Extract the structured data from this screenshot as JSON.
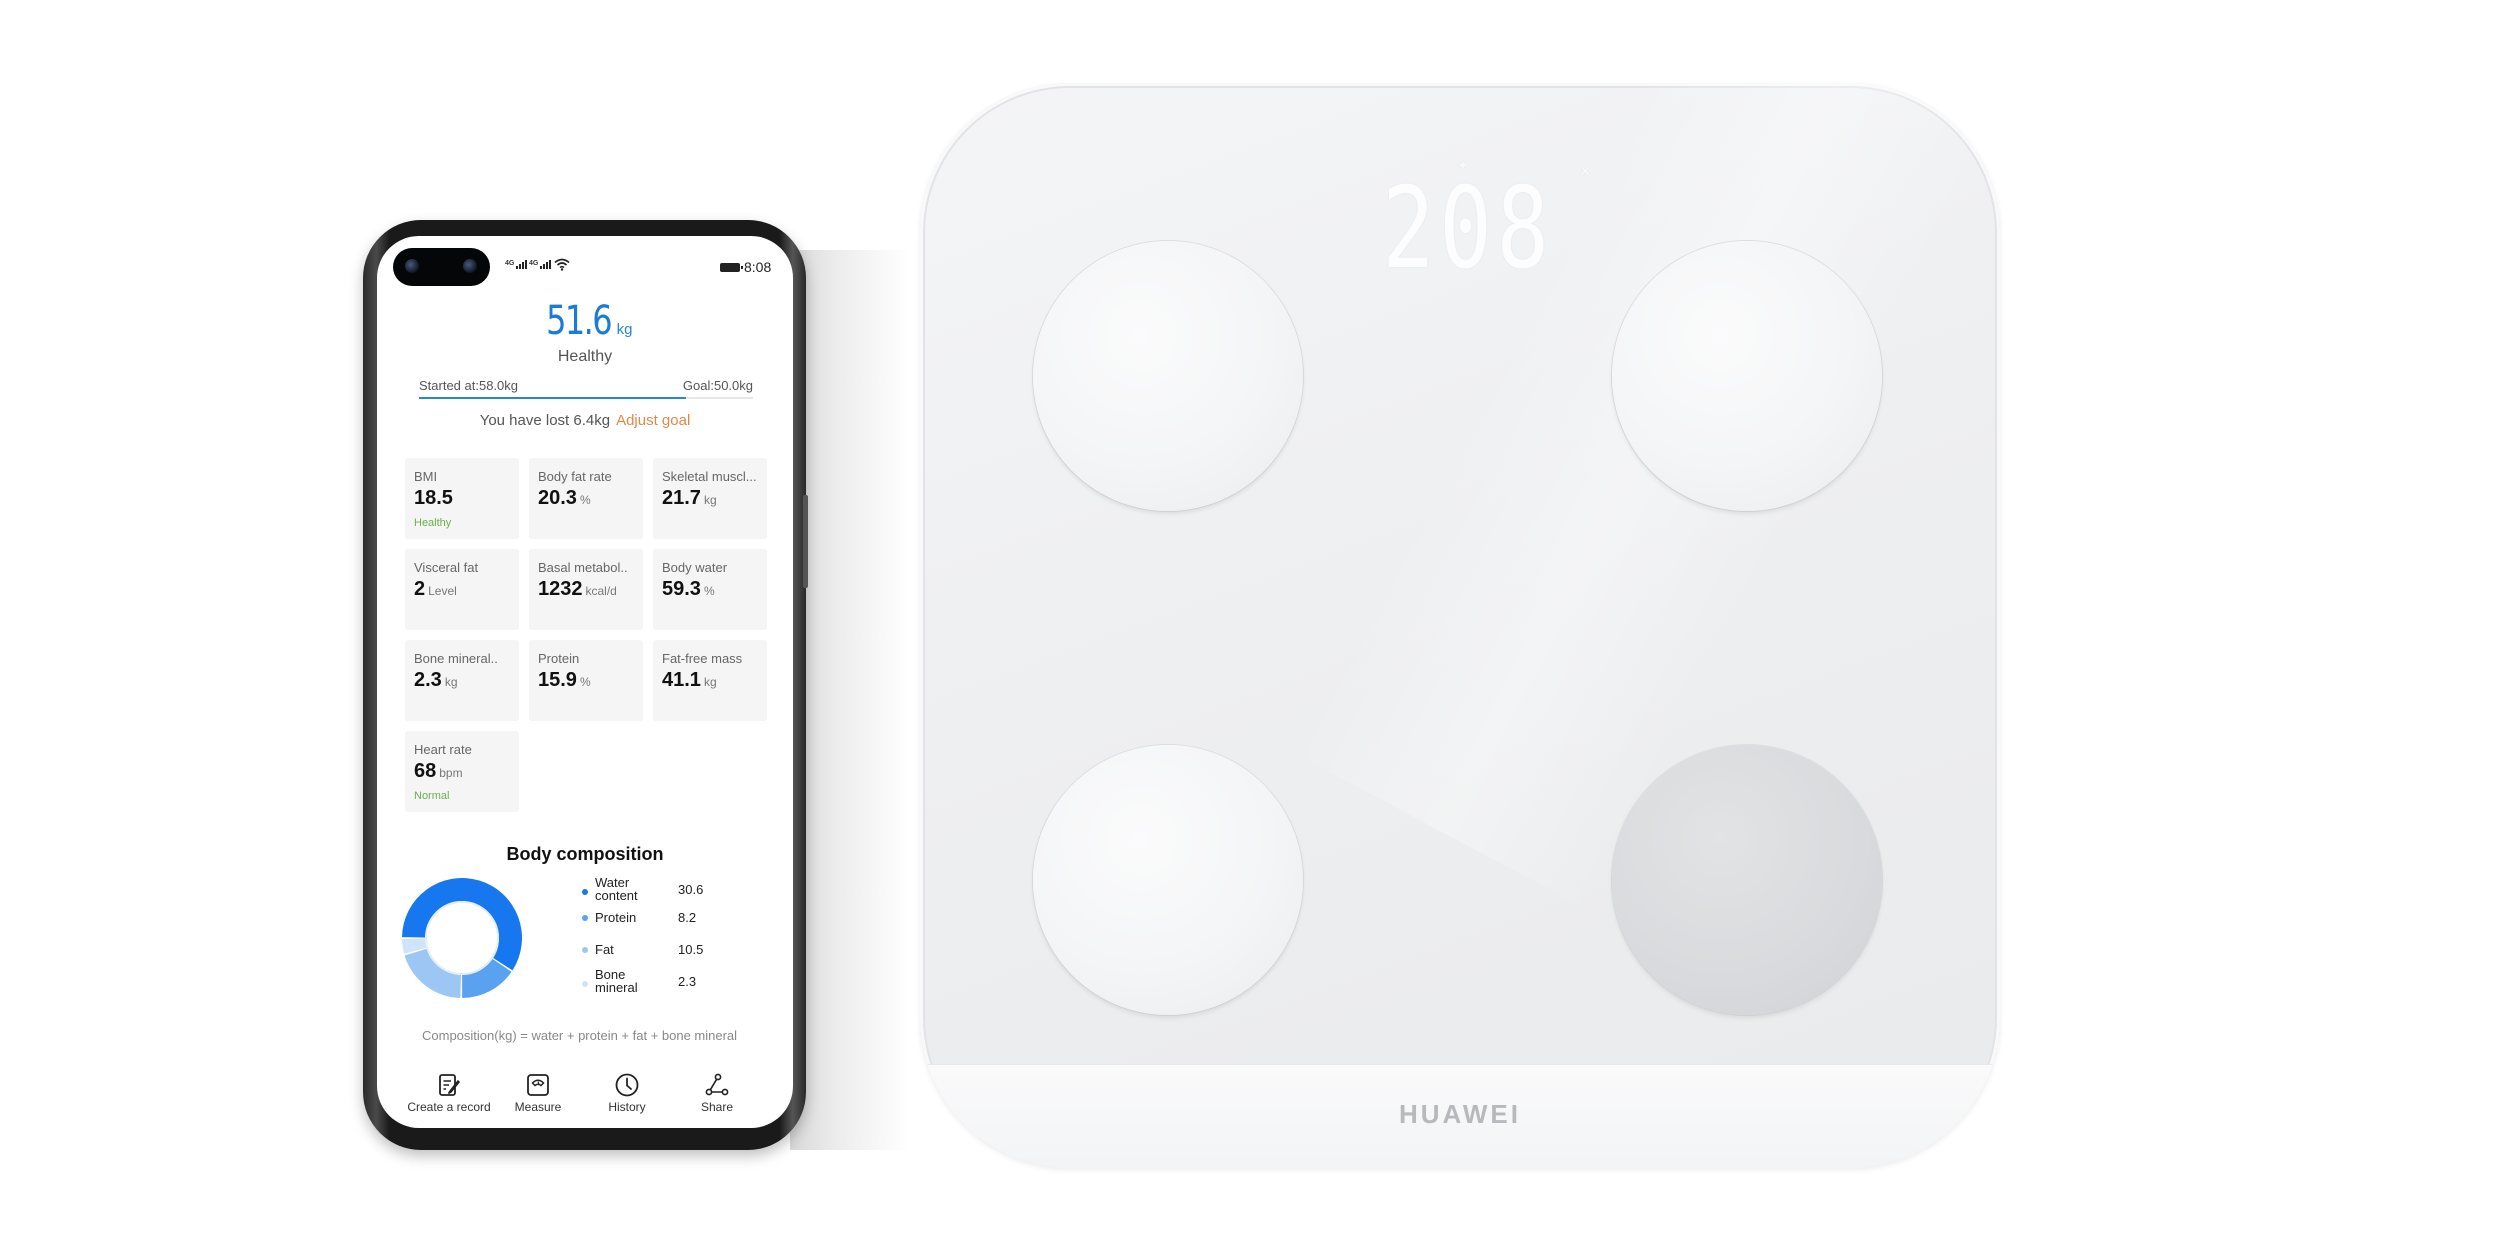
{
  "status_bar": {
    "network_1": "4G",
    "network_2": "4G",
    "wifi_icon": "wifi-icon",
    "battery_icon": "battery-icon",
    "time": "8:08"
  },
  "summary": {
    "weight_value": "51.6",
    "weight_unit": "kg",
    "status": "Healthy",
    "started_label": "Started at:58.0kg",
    "goal_label": "Goal:50.0kg",
    "progress_percent": 80,
    "lost_text": "You have lost 6.4kg",
    "adjust_goal_label": "Adjust goal",
    "accent_color": "#1c7bd3",
    "link_color": "#e0884a"
  },
  "metrics": [
    {
      "label": "BMI",
      "value": "18.5",
      "unit": "",
      "status": "Healthy"
    },
    {
      "label": "Body fat rate",
      "value": "20.3",
      "unit": "%",
      "status": ""
    },
    {
      "label": "Skeletal muscl...",
      "value": "21.7",
      "unit": "kg",
      "status": ""
    },
    {
      "label": "Visceral fat",
      "value": "2",
      "unit": "Level",
      "status": ""
    },
    {
      "label": "Basal metabol..",
      "value": "1232",
      "unit": "kcal/d",
      "status": ""
    },
    {
      "label": "Body water",
      "value": "59.3",
      "unit": "%",
      "status": ""
    },
    {
      "label": "Bone mineral..",
      "value": "2.3",
      "unit": "kg",
      "status": ""
    },
    {
      "label": "Protein",
      "value": "15.9",
      "unit": "%",
      "status": ""
    },
    {
      "label": "Fat-free mass",
      "value": "41.1",
      "unit": "kg",
      "status": ""
    },
    {
      "label": "Heart rate",
      "value": "68",
      "unit": "bpm",
      "status": "Normal"
    }
  ],
  "body_composition": {
    "title": "Body composition",
    "formula": "Composition(kg) = water + protein + fat + bone mineral",
    "items": [
      {
        "name_line1": "Water",
        "name_line2": "content",
        "value": "30.6",
        "color": "#1677ee"
      },
      {
        "name_line1": "Protein",
        "name_line2": "",
        "value": "8.2",
        "color": "#5aa2f0"
      },
      {
        "name_line1": "Fat",
        "name_line2": "",
        "value": "10.5",
        "color": "#9cc7f5"
      },
      {
        "name_line1": "Bone",
        "name_line2": "mineral",
        "value": "2.3",
        "color": "#cfe3fa"
      }
    ]
  },
  "chart_data": {
    "type": "pie",
    "title": "Body composition",
    "categories": [
      "Water content",
      "Protein",
      "Fat",
      "Bone mineral"
    ],
    "values": [
      30.6,
      8.2,
      10.5,
      2.3
    ],
    "colors": [
      "#1677ee",
      "#5aa2f0",
      "#9cc7f5",
      "#cfe3fa"
    ],
    "donut": true,
    "legend": "right"
  },
  "bottom_nav": [
    {
      "label": "Create a record",
      "icon": "create-record-icon"
    },
    {
      "label": "Measure",
      "icon": "measure-icon"
    },
    {
      "label": "History",
      "icon": "history-icon"
    },
    {
      "label": "Share",
      "icon": "share-icon"
    }
  ],
  "scale": {
    "display_reading": "208",
    "brand": "HUAWEI"
  }
}
